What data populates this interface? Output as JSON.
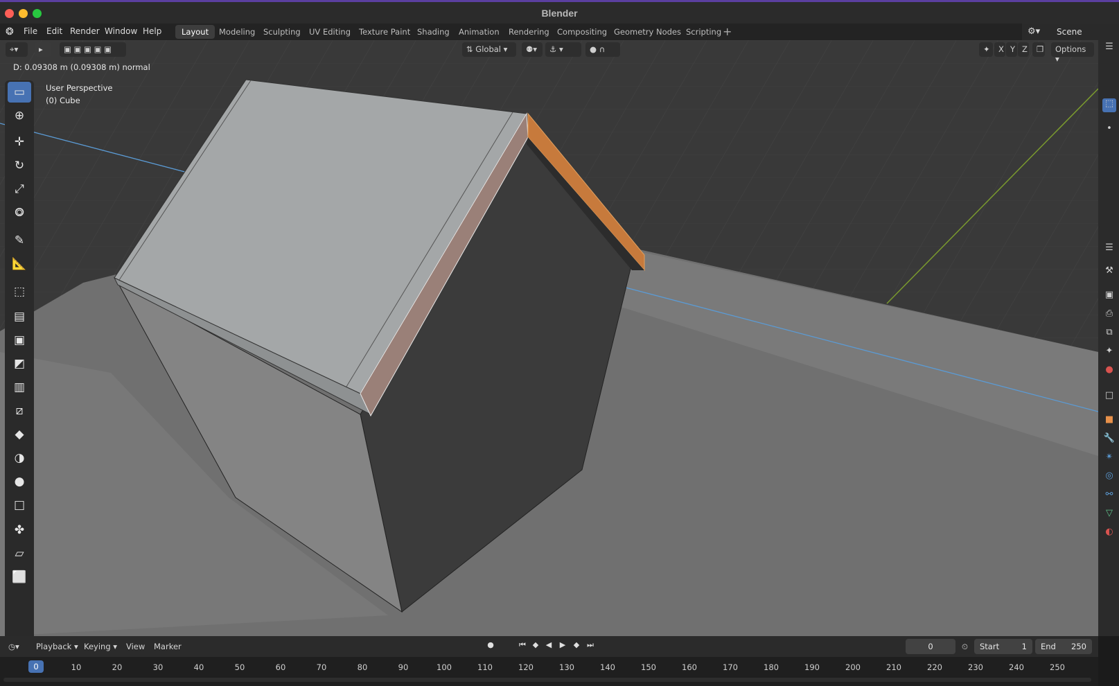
{
  "window": {
    "title": "Blender"
  },
  "menu": {
    "items": [
      "File",
      "Edit",
      "Render",
      "Window",
      "Help"
    ]
  },
  "workspaces": {
    "tabs": [
      "Layout",
      "Modeling",
      "Sculpting",
      "UV Editing",
      "Texture Paint",
      "Shading",
      "Animation",
      "Rendering",
      "Compositing",
      "Geometry Nodes",
      "Scripting"
    ],
    "active": "Layout",
    "add_icon": "plus-icon"
  },
  "scene": {
    "label": "Scene",
    "icon": "scene-icon"
  },
  "viewport_header": {
    "transform_orientation": "Global",
    "axes": [
      "X",
      "Y",
      "Z"
    ],
    "options_label": "Options"
  },
  "status": {
    "text": "D: 0.09308 m (0.09308 m) normal"
  },
  "overlay": {
    "perspective": "User Perspective",
    "object": "(0) Cube"
  },
  "toolbar": {
    "tools": [
      "select-box-icon",
      "cursor-icon",
      "move-icon",
      "rotate-icon",
      "scale-icon",
      "transform-icon",
      "annotate-icon",
      "measure-icon",
      "add-cube-icon",
      "extrude-icon",
      "inset-icon",
      "bevel-icon",
      "loop-cut-icon",
      "knife-icon",
      "poly-build-icon",
      "spin-icon",
      "smooth-icon",
      "edge-slide-icon",
      "shrink-fatten-icon",
      "shear-icon",
      "rip-region-icon"
    ],
    "active_index": 0
  },
  "timeline": {
    "menus": [
      "Playback",
      "Keying",
      "View",
      "Marker"
    ],
    "current_frame": "0",
    "start_label": "Start",
    "start_value": "1",
    "end_label": "End",
    "end_value": "250",
    "ruler_labels": [
      "0",
      "10",
      "20",
      "30",
      "40",
      "50",
      "60",
      "70",
      "80",
      "90",
      "100",
      "110",
      "120",
      "130",
      "140",
      "150",
      "160",
      "170",
      "180",
      "190",
      "200",
      "210",
      "220",
      "230",
      "240",
      "250"
    ]
  },
  "colors": {
    "accent": "#4772b3",
    "selected_edge": "#c77a3c",
    "x_axis": "#5b9bd5",
    "y_axis": "#7a9a2e"
  }
}
